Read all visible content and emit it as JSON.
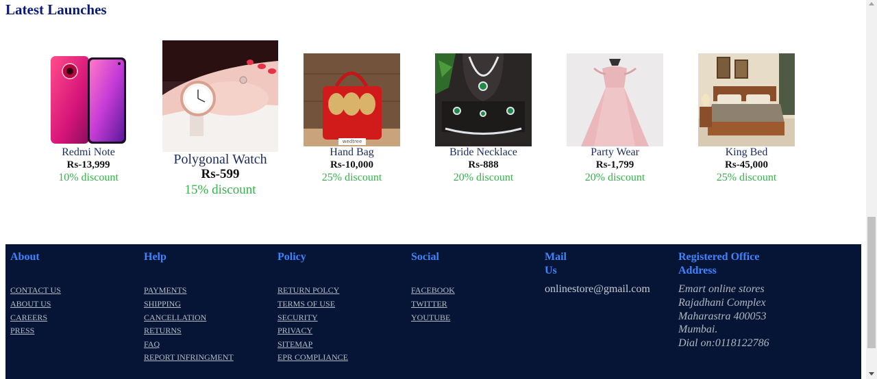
{
  "section": {
    "title": "Latest Launches"
  },
  "products": [
    {
      "name": "Redmi Note",
      "price": "Rs-13,999",
      "discount": "10% discount"
    },
    {
      "name": "Polygonal Watch",
      "price": "Rs-599",
      "discount": "15% discount"
    },
    {
      "name": "Hand Bag",
      "price": "Rs-10,000",
      "discount": "25% discount",
      "image_text": "wedtree"
    },
    {
      "name": "Bride Necklace",
      "price": "Rs-888",
      "discount": "20% discount"
    },
    {
      "name": "Party Wear",
      "price": "Rs-1,799",
      "discount": "20% discount"
    },
    {
      "name": "King Bed",
      "price": "Rs-45,000",
      "discount": "25% discount"
    }
  ],
  "footer": {
    "about": {
      "title": "About",
      "links": [
        "CONTACT US",
        "ABOUT US",
        "CAREERS",
        "PRESS"
      ]
    },
    "help": {
      "title": "Help",
      "links": [
        "PAYMENTS",
        "SHIPPING",
        "CANCELLATION",
        "RETURNS",
        "FAQ",
        "REPORT INFRINGMENT"
      ]
    },
    "policy": {
      "title": "Policy",
      "links": [
        "RETURN POLCY",
        "TERMS OF USE",
        "SECURITY",
        "PRIVACY",
        "SITEMAP",
        "EPR COMPLIANCE"
      ]
    },
    "social": {
      "title": "Social",
      "links": [
        "FACEBOOK",
        "TWITTER",
        "YOUTUBE"
      ]
    },
    "mail": {
      "title": "Mail Us",
      "email": "onlinestore@gmail.com"
    },
    "office": {
      "title_line1": "Registered Office",
      "title_line2": "Address",
      "lines": [
        "Emart online stores",
        "Rajadhani Complex",
        "Maharastra 400053",
        "Mumbai.",
        "Dial on:0118122786"
      ]
    }
  },
  "colors": {
    "footer_bg": "#061535",
    "heading": "#0a1a7a",
    "footer_title": "#3f84ff",
    "discount": "#35b24a"
  }
}
